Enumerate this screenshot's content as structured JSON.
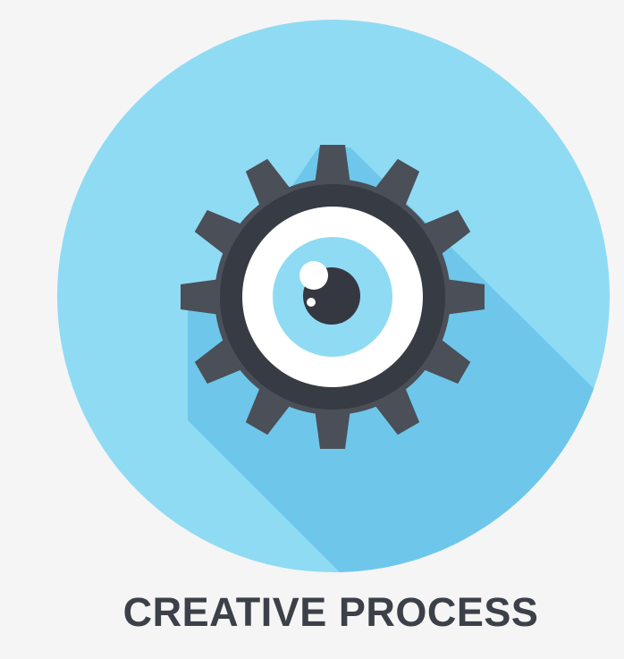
{
  "caption": {
    "text": "CREATIVE PROCESS"
  },
  "icon": {
    "name": "gear-eye-icon",
    "colors": {
      "background": "#f5f5f5",
      "circle": "#8fdbf3",
      "shadow": "#6ec7ea",
      "gear_outer": "#4a4f58",
      "gear_ring": "#373b43",
      "white_ring": "#ffffff",
      "iris": "#8fdbf3",
      "pupil": "#353841",
      "highlight": "#ffffff"
    }
  }
}
